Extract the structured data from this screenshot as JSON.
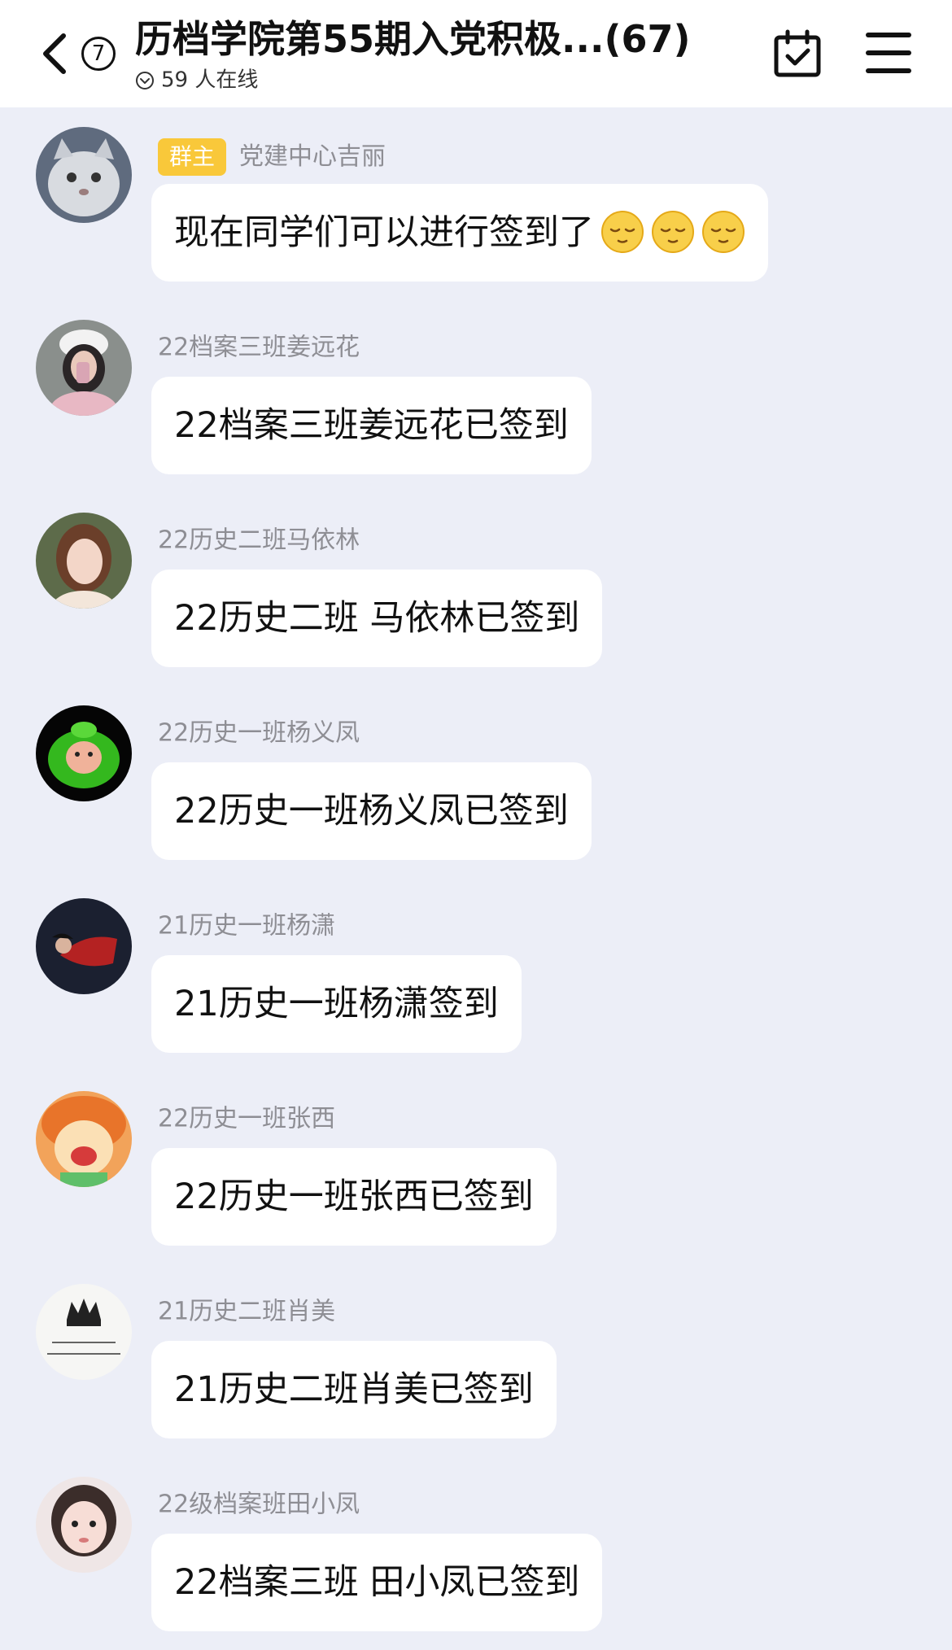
{
  "header": {
    "unread_count": "7",
    "title": "历档学院第55期入党积极...(67)",
    "online_status": "59 人在线"
  },
  "messages": [
    {
      "role_badge": "群主",
      "sender": "党建中心吉丽",
      "text": "现在同学们可以进行签到了",
      "emoji": [
        "relieved-face-icon",
        "relieved-face-icon",
        "relieved-face-icon"
      ]
    },
    {
      "sender": "22档案三班姜远花",
      "text": "22档案三班姜远花已签到"
    },
    {
      "sender": "22历史二班马依林",
      "text": "22历史二班 马依林已签到"
    },
    {
      "sender": "22历史一班杨义凤",
      "text": "22历史一班杨义凤已签到"
    },
    {
      "sender": "21历史一班杨潇",
      "text": "21历史一班杨潇签到"
    },
    {
      "sender": "22历史一班张西",
      "text": "22历史一班张西已签到"
    },
    {
      "sender": "21历史二班肖美",
      "text": "21历史二班肖美已签到"
    },
    {
      "sender": "22级档案班田小凤",
      "text": "22档案三班 田小凤已签到"
    }
  ],
  "colors": {
    "background": "#eceef7",
    "bubble": "#ffffff",
    "owner_badge": "#f9c83a",
    "sender_name": "#8e8e94"
  }
}
